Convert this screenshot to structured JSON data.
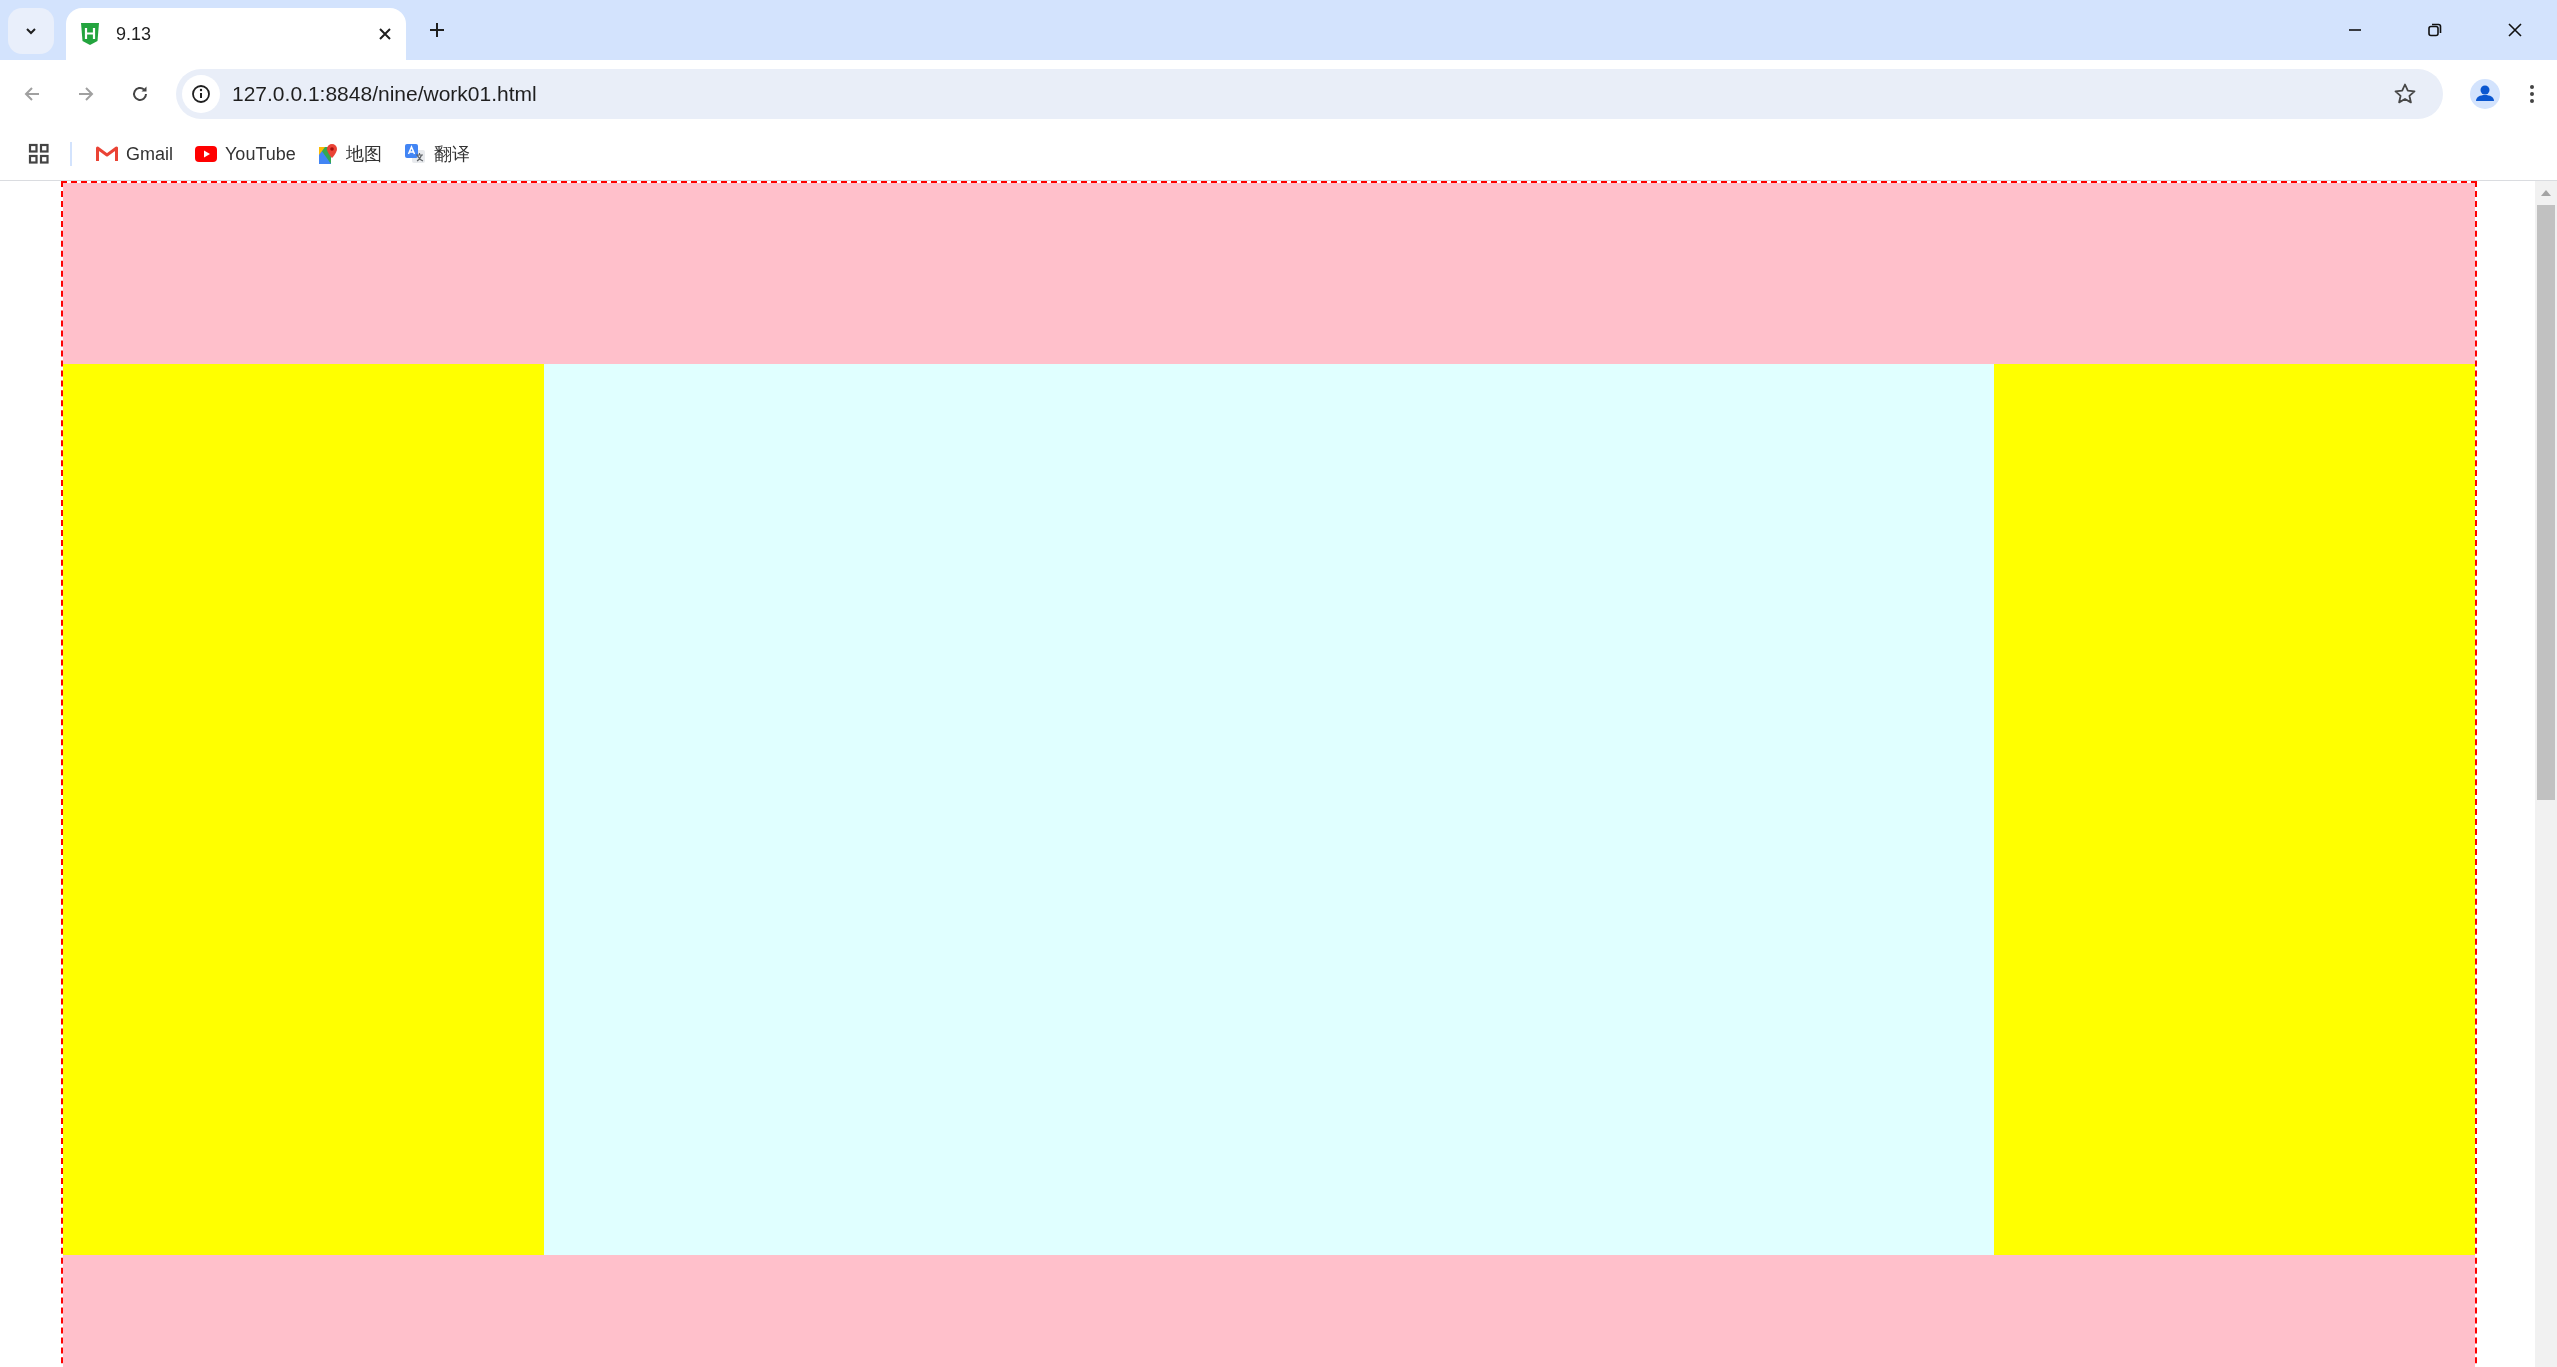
{
  "tabs": [
    {
      "title": "9.13",
      "selected": true
    }
  ],
  "address_bar": {
    "url": "127.0.0.1:8848/nine/work01.html"
  },
  "bookmarks": [
    {
      "label": "Gmail",
      "kind": "gmail"
    },
    {
      "label": "YouTube",
      "kind": "youtube"
    },
    {
      "label": "地图",
      "kind": "maps"
    },
    {
      "label": "翻译",
      "kind": "translate"
    }
  ]
}
